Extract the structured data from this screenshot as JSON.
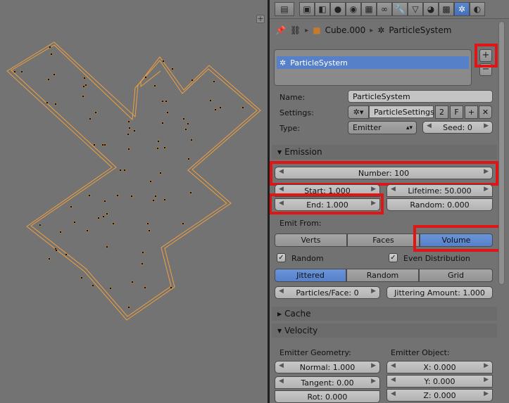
{
  "breadcrumb": {
    "object": "Cube.000",
    "system": "ParticleSystem"
  },
  "list": {
    "selected": "ParticleSystem"
  },
  "props": {
    "name_label": "Name:",
    "name_value": "ParticleSystem",
    "settings_label": "Settings:",
    "settings_value": "ParticleSettings",
    "users": "2",
    "fake_user": "F",
    "type_label": "Type:",
    "type_value": "Emitter",
    "seed": "Seed: 0"
  },
  "emission": {
    "header": "Emission",
    "number": "Number: 100",
    "start": "Start: 1.000",
    "end": "End: 1.000",
    "lifetime": "Lifetime: 50.000",
    "random": "Random: 0.000",
    "emit_from_label": "Emit From:",
    "emit_from": [
      "Verts",
      "Faces",
      "Volume"
    ],
    "random_cb": "Random",
    "even_cb": "Even Distribution",
    "distribution": [
      "Jittered",
      "Random",
      "Grid"
    ],
    "particles_face": "Particles/Face: 0",
    "jitter": "Jittering Amount: 1.000"
  },
  "cache": {
    "header": "Cache"
  },
  "velocity": {
    "header": "Velocity",
    "geom_label": "Emitter Geometry:",
    "obj_label": "Emitter Object:",
    "normal": "Normal: 1.000",
    "tangent": "Tangent: 0.00",
    "rot": "Rot: 0.000",
    "x": "X: 0.000",
    "y": "Y: 0.000",
    "z": "Z: 0.000"
  },
  "colors": {
    "accent": "#5680c8",
    "highlight": "#e01515",
    "wire": "#f0a040"
  },
  "icons": [
    "view-icon",
    "render-icon",
    "layers-icon",
    "scene-icon",
    "world-icon",
    "object-icon",
    "constraints-icon",
    "modifiers-icon",
    "data-icon",
    "material-icon",
    "texture-icon",
    "particles-icon",
    "physics-icon",
    "pin-icon"
  ]
}
